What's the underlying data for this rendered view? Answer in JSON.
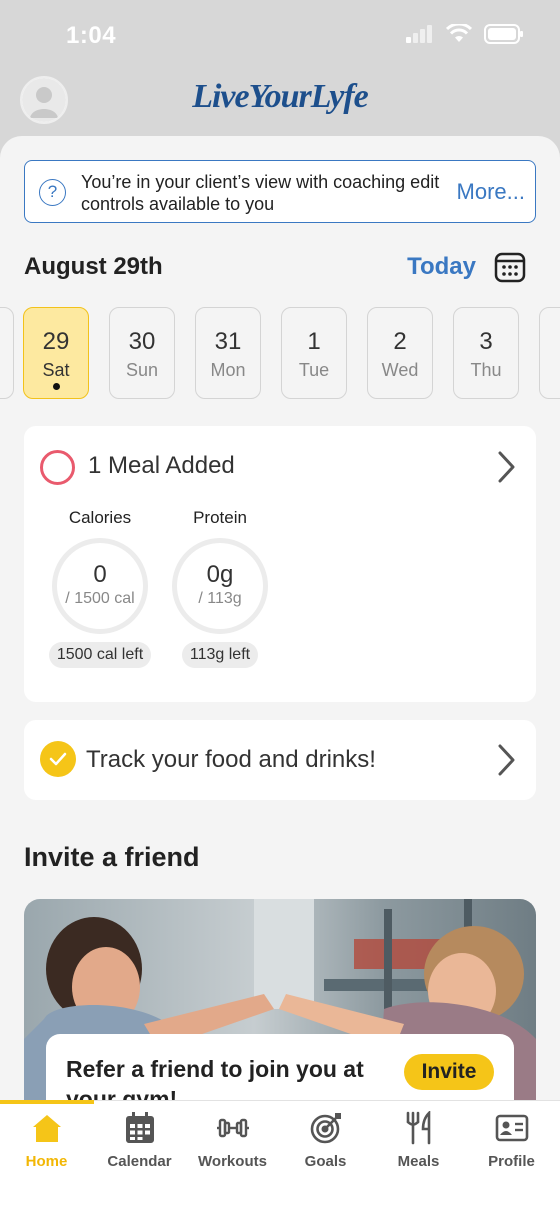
{
  "status": {
    "time": "1:04"
  },
  "header": {
    "logo_text": "LiveYourLyfe"
  },
  "coach_banner": {
    "message": "You’re in your client’s view with coaching edit controls available to you",
    "more_label": "More..."
  },
  "date_header": {
    "title": "August 29th",
    "today_label": "Today"
  },
  "days": [
    {
      "num": "29",
      "dow": "Sat",
      "selected": true,
      "has_dot": true
    },
    {
      "num": "30",
      "dow": "Sun"
    },
    {
      "num": "31",
      "dow": "Mon"
    },
    {
      "num": "1",
      "dow": "Tue"
    },
    {
      "num": "2",
      "dow": "Wed"
    },
    {
      "num": "3",
      "dow": "Thu"
    }
  ],
  "meal_card": {
    "title": "1 Meal Added",
    "calories": {
      "label": "Calories",
      "value": "0",
      "goal": "/ 1500 cal",
      "left": "1500 cal left"
    },
    "protein": {
      "label": "Protein",
      "value": "0g",
      "goal": "/ 113g",
      "left": "113g left"
    }
  },
  "track_card": {
    "title": "Track your food and drinks!"
  },
  "invite": {
    "section_title": "Invite a friend",
    "refer_text": "Refer a friend to join you at your gym!",
    "button_label": "Invite"
  },
  "fab": {
    "label": "+"
  },
  "tabs": [
    {
      "label": "Home",
      "icon": "home-icon",
      "active": true
    },
    {
      "label": "Calendar",
      "icon": "calendar-icon"
    },
    {
      "label": "Workouts",
      "icon": "dumbbell-icon"
    },
    {
      "label": "Goals",
      "icon": "target-icon"
    },
    {
      "label": "Meals",
      "icon": "fork-knife-icon"
    },
    {
      "label": "Profile",
      "icon": "profile-card-icon"
    }
  ],
  "colors": {
    "accent": "#f5c518",
    "link": "#3a78c2",
    "meal_ring": "#e95a6d",
    "brand": "#1d4f8c"
  }
}
